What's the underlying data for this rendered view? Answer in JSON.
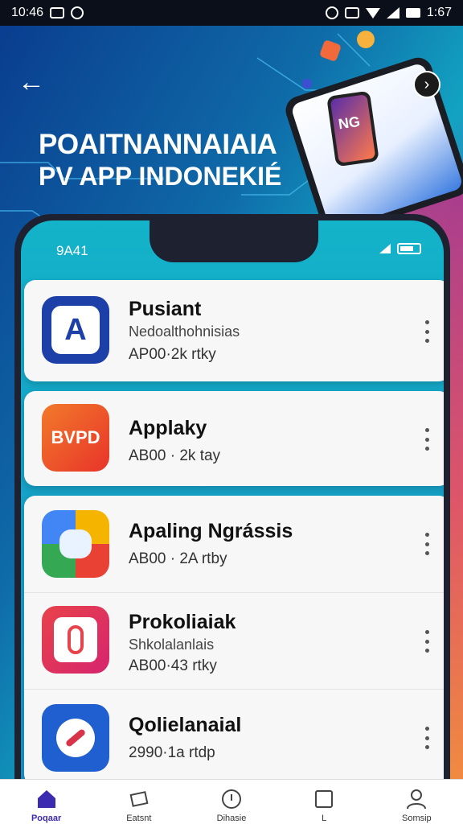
{
  "status_bar": {
    "time_left": "10:46",
    "time_right": "1:67"
  },
  "hero": {
    "headline_line1": "POAITNANNAIAIA",
    "headline_line2": "PV APP INDONEKIÉ",
    "deco_screen_text": "NG"
  },
  "phone": {
    "time": "9A41"
  },
  "apps": [
    {
      "name": "Pusiant",
      "subtitle": "Nedoalthohnisias",
      "meta": "AP00·2k rtky",
      "icon_text": "A",
      "icon_color": "#1d3fa8"
    },
    {
      "name": "Applaky",
      "subtitle": "",
      "meta": "AB00 · 2k tay",
      "icon_text": "BVPD",
      "icon_color": "#f0532a"
    },
    {
      "name": "Apaling Ngrássis",
      "subtitle": "",
      "meta": "AB00 · 2A rtby",
      "icon_text": "",
      "icon_color": "#2a8ae0"
    },
    {
      "name": "Prokoliaiak",
      "subtitle": "Shkolalanlais",
      "meta": "AB00·43 rtky",
      "icon_text": "",
      "icon_color": "#e8434a"
    },
    {
      "name": "Qolielanaial",
      "subtitle": "",
      "meta": "2990·1a rtdp",
      "icon_text": "",
      "icon_color": "#1f5fd0"
    }
  ],
  "nav": [
    {
      "label": "Poqaar",
      "icon": "home-icon"
    },
    {
      "label": "Eatsnt",
      "icon": "cards-icon"
    },
    {
      "label": "Dihasie",
      "icon": "info-icon"
    },
    {
      "label": "L",
      "icon": "square-icon"
    },
    {
      "label": "Somsip",
      "icon": "person-icon"
    }
  ],
  "colors": {
    "nav_active": "#3a2bb0",
    "card_bg": "#f7f7f8"
  }
}
